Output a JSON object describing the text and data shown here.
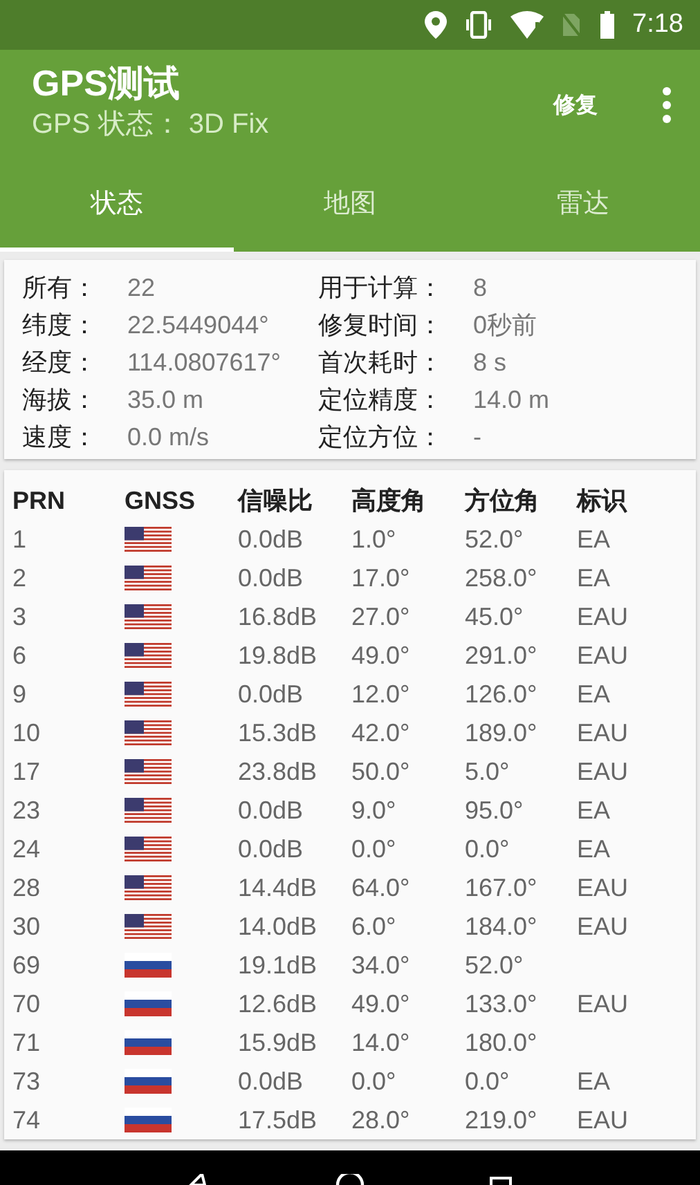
{
  "status_bar": {
    "time": "7:18"
  },
  "app_bar": {
    "title": "GPS测试",
    "subtitle": "GPS 状态： 3D Fix",
    "action": "修复"
  },
  "tabs": [
    {
      "label": "状态",
      "selected": true
    },
    {
      "label": "地图",
      "selected": false
    },
    {
      "label": "雷达",
      "selected": false
    }
  ],
  "summary": [
    {
      "label": "所有：",
      "value": "22"
    },
    {
      "label": "用于计算：",
      "value": "8"
    },
    {
      "label": "纬度：",
      "value": "22.5449044°"
    },
    {
      "label": "修复时间：",
      "value": "0秒前"
    },
    {
      "label": "经度：",
      "value": "114.0807617°"
    },
    {
      "label": "首次耗时：",
      "value": "8 s"
    },
    {
      "label": "海拔：",
      "value": "35.0 m"
    },
    {
      "label": "定位精度：",
      "value": "14.0 m"
    },
    {
      "label": "速度：",
      "value": "0.0 m/s"
    },
    {
      "label": "定位方位：",
      "value": "-"
    }
  ],
  "table": {
    "columns": [
      "PRN",
      "GNSS",
      "信噪比",
      "高度角",
      "方位角",
      "标识"
    ],
    "rows": [
      {
        "prn": "1",
        "kind": "us",
        "snr": "0.0dB",
        "elevation": "1.0°",
        "azimuth": "52.0°",
        "flags": "EA"
      },
      {
        "prn": "2",
        "kind": "us",
        "snr": "0.0dB",
        "elevation": "17.0°",
        "azimuth": "258.0°",
        "flags": "EA"
      },
      {
        "prn": "3",
        "kind": "us",
        "snr": "16.8dB",
        "elevation": "27.0°",
        "azimuth": "45.0°",
        "flags": "EAU"
      },
      {
        "prn": "6",
        "kind": "us",
        "snr": "19.8dB",
        "elevation": "49.0°",
        "azimuth": "291.0°",
        "flags": "EAU"
      },
      {
        "prn": "9",
        "kind": "us",
        "snr": "0.0dB",
        "elevation": "12.0°",
        "azimuth": "126.0°",
        "flags": "EA"
      },
      {
        "prn": "10",
        "kind": "us",
        "snr": "15.3dB",
        "elevation": "42.0°",
        "azimuth": "189.0°",
        "flags": "EAU"
      },
      {
        "prn": "17",
        "kind": "us",
        "snr": "23.8dB",
        "elevation": "50.0°",
        "azimuth": "5.0°",
        "flags": "EAU"
      },
      {
        "prn": "23",
        "kind": "us",
        "snr": "0.0dB",
        "elevation": "9.0°",
        "azimuth": "95.0°",
        "flags": "EA"
      },
      {
        "prn": "24",
        "kind": "us",
        "snr": "0.0dB",
        "elevation": "0.0°",
        "azimuth": "0.0°",
        "flags": "EA"
      },
      {
        "prn": "28",
        "kind": "us",
        "snr": "14.4dB",
        "elevation": "64.0°",
        "azimuth": "167.0°",
        "flags": "EAU"
      },
      {
        "prn": "30",
        "kind": "us",
        "snr": "14.0dB",
        "elevation": "6.0°",
        "azimuth": "184.0°",
        "flags": "EAU"
      },
      {
        "prn": "69",
        "kind": "ru",
        "snr": "19.1dB",
        "elevation": "34.0°",
        "azimuth": "52.0°"
      },
      {
        "prn": "70",
        "kind": "ru",
        "snr": "12.6dB",
        "elevation": "49.0°",
        "azimuth": "133.0°",
        "flags": "EAU"
      },
      {
        "prn": "71",
        "kind": "ru",
        "snr": "15.9dB",
        "elevation": "14.0°",
        "azimuth": "180.0°"
      },
      {
        "prn": "73",
        "kind": "ru",
        "snr": "0.0dB",
        "elevation": "0.0°",
        "azimuth": "0.0°",
        "flags": "EA"
      },
      {
        "prn": "74",
        "kind": "ru",
        "snr": "17.5dB",
        "elevation": "28.0°",
        "azimuth": "219.0°",
        "flags": "EAU"
      }
    ]
  }
}
